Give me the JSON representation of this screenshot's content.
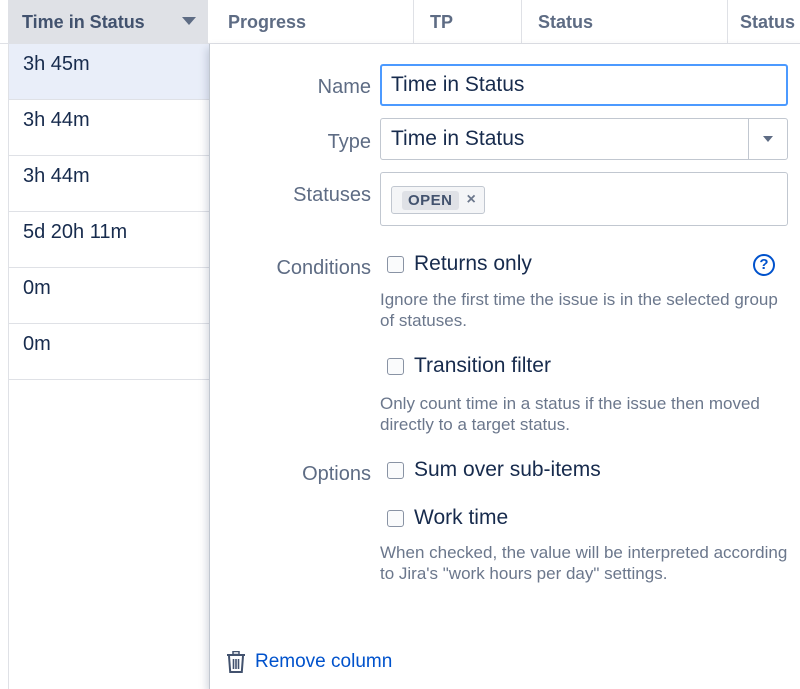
{
  "header": {
    "active_col": "Time in Status",
    "cols": [
      "Progress",
      "TP",
      "Status",
      "Status"
    ]
  },
  "rows": [
    "3h 45m",
    "3h 44m",
    "3h 44m",
    "5d 20h 11m",
    "0m",
    "0m"
  ],
  "form": {
    "name_label": "Name",
    "name_value": "Time in Status",
    "type_label": "Type",
    "type_value": "Time in Status",
    "statuses_label": "Statuses",
    "status_tag": "OPEN",
    "tag_remove": "×",
    "conditions_label": "Conditions",
    "returns_only": "Returns only",
    "returns_only_desc": "Ignore the first time the issue is in the selected group of statuses.",
    "help": "?",
    "transition_filter": "Transition filter",
    "transition_filter_desc": "Only count time in a status if the issue then moved directly to a target status.",
    "options_label": "Options",
    "sum_over": "Sum over sub-items",
    "work_time": "Work time",
    "work_time_desc": "When checked, the value will be interpreted according to Jira's \"work hours per day\" settings.",
    "remove_column": "Remove column"
  },
  "icons": {
    "dropdown": "chevron-down-icon",
    "help": "question-circle-icon",
    "remove": "trash-icon"
  },
  "colors": {
    "accent": "#0052cc",
    "focus_border": "#4c9aff",
    "header_active_bg": "#dfe1e6",
    "selected_row_bg": "#e9eef9"
  }
}
